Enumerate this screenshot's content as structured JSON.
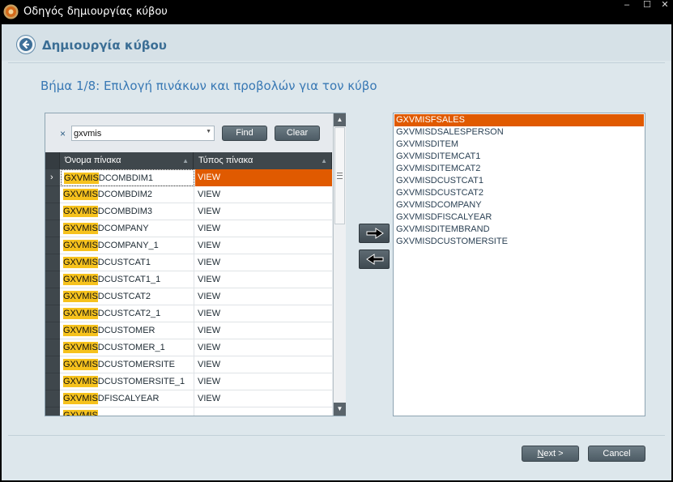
{
  "window": {
    "title": "Οδηγός δημιουργίας κύβου",
    "controls": {
      "minimize": "–",
      "maximize": "☐",
      "close": "✕"
    },
    "icon": "app-logo-icon"
  },
  "header": {
    "back_icon": "back-arrow-icon",
    "title": "Δημιουργία κύβου"
  },
  "step": {
    "title": "Βήμα 1/8: Επιλογή πινάκων και προβολών για τον κύβο"
  },
  "filter": {
    "clear_glyph": "×",
    "value": "gxvmis",
    "find_label": "Find",
    "clear_label": "Clear"
  },
  "grid": {
    "columns": [
      "Όνομα πίνακα",
      "Τύπος πίνακα"
    ],
    "highlight": "GXVMIS",
    "rows": [
      {
        "prefix": "GXVMIS",
        "suffix": "DCOMBDIM1",
        "type": "VIEW",
        "selected": true
      },
      {
        "prefix": "GXVMIS",
        "suffix": "DCOMBDIM2",
        "type": "VIEW"
      },
      {
        "prefix": "GXVMIS",
        "suffix": "DCOMBDIM3",
        "type": "VIEW"
      },
      {
        "prefix": "GXVMIS",
        "suffix": "DCOMPANY",
        "type": "VIEW"
      },
      {
        "prefix": "GXVMIS",
        "suffix": "DCOMPANY_1",
        "type": "VIEW"
      },
      {
        "prefix": "GXVMIS",
        "suffix": "DCUSTCAT1",
        "type": "VIEW"
      },
      {
        "prefix": "GXVMIS",
        "suffix": "DCUSTCAT1_1",
        "type": "VIEW"
      },
      {
        "prefix": "GXVMIS",
        "suffix": "DCUSTCAT2",
        "type": "VIEW"
      },
      {
        "prefix": "GXVMIS",
        "suffix": "DCUSTCAT2_1",
        "type": "VIEW"
      },
      {
        "prefix": "GXVMIS",
        "suffix": "DCUSTOMER",
        "type": "VIEW"
      },
      {
        "prefix": "GXVMIS",
        "suffix": "DCUSTOMER_1",
        "type": "VIEW"
      },
      {
        "prefix": "GXVMIS",
        "suffix": "DCUSTOMERSITE",
        "type": "VIEW"
      },
      {
        "prefix": "GXVMIS",
        "suffix": "DCUSTOMERSITE_1",
        "type": "VIEW"
      },
      {
        "prefix": "GXVMIS",
        "suffix": "DFISCALYEAR",
        "type": "VIEW"
      },
      {
        "prefix": "GXVMIS",
        "suffix": "",
        "type": ""
      }
    ]
  },
  "selected_list": [
    {
      "label": "GXVMISFSALES",
      "selected": true
    },
    {
      "label": "GXVMISDSALESPERSON"
    },
    {
      "label": "GXVMISDITEM"
    },
    {
      "label": "GXVMISDITEMCAT1"
    },
    {
      "label": "GXVMISDITEMCAT2"
    },
    {
      "label": "GXVMISDCUSTCAT1"
    },
    {
      "label": "GXVMISDCUSTCAT2"
    },
    {
      "label": "GXVMISDCOMPANY"
    },
    {
      "label": "GXVMISDFISCALYEAR"
    },
    {
      "label": "GXVMISDITEMBRAND"
    },
    {
      "label": "GXVMISDCUSTOMERSITE"
    }
  ],
  "footer": {
    "next_label": "Next >",
    "next_underline": "N",
    "next_rest": "ext >",
    "cancel_label": "Cancel"
  },
  "colors": {
    "accent": "#e05a00",
    "highlight": "#f6c21d",
    "title_blue": "#3b6e95",
    "step_blue": "#3878b4"
  }
}
